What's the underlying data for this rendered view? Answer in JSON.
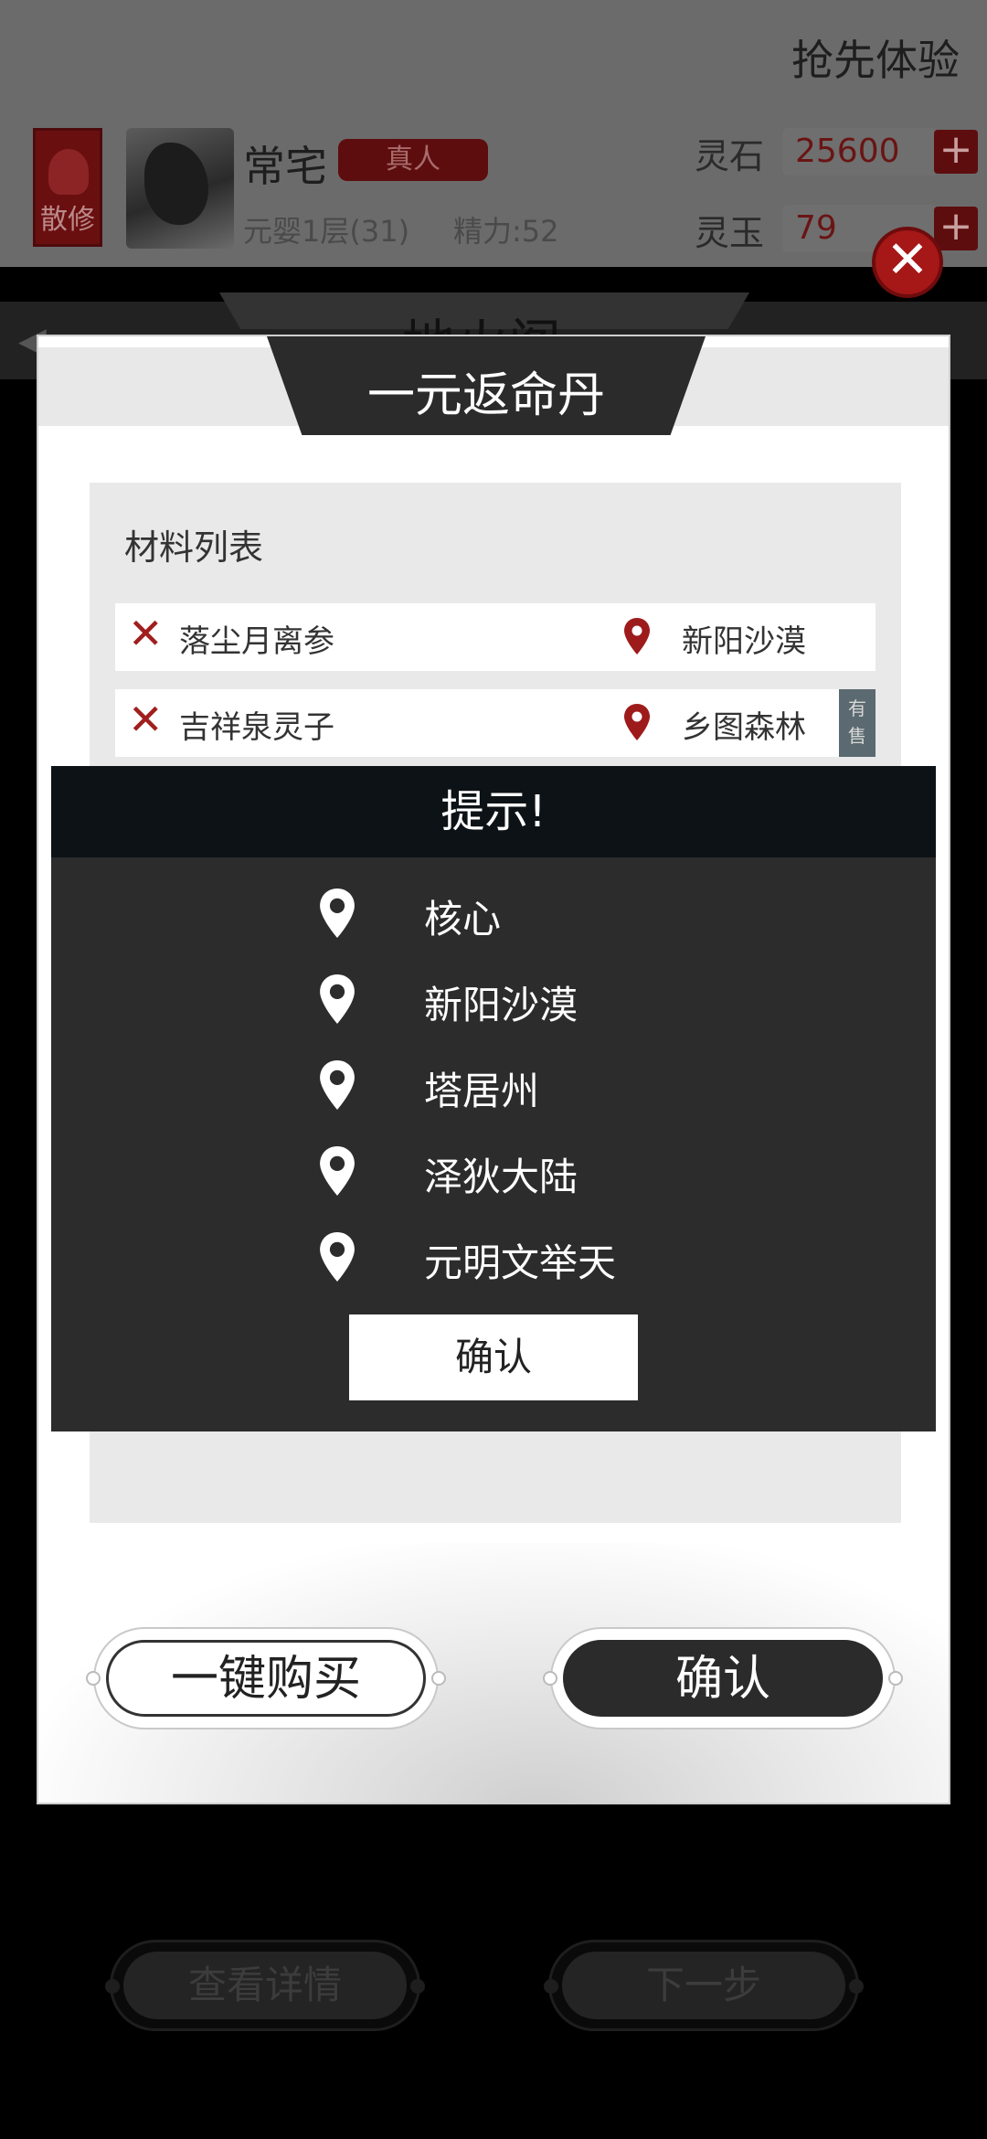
{
  "header": {
    "early_experience": "抢先体验",
    "badge_label": "散修",
    "player_name": "常宅",
    "real_tag": "真人",
    "realm": "元婴1层(31)",
    "energy": "精力:52",
    "resources": [
      {
        "label": "灵石",
        "value": "25600",
        "plus": "+"
      },
      {
        "label": "灵玉",
        "value": "79",
        "plus": "+"
      }
    ]
  },
  "background_page": {
    "title": "地火阁",
    "back_label": "◀",
    "bottom_buttons": [
      "查看详情",
      "下一步"
    ]
  },
  "close_symbol": "✕",
  "recipe": {
    "title": "一元返命丹",
    "materials_title": "材料列表",
    "materials": [
      {
        "status_icon": "✕",
        "name": "落尘月离参",
        "location": "新阳沙漠",
        "sale": ""
      },
      {
        "status_icon": "✕",
        "name": "吉祥泉灵子",
        "location": "乡图森林",
        "sale": "有售"
      }
    ],
    "buy_all_label": "一键购买",
    "confirm_label": "确认"
  },
  "hint": {
    "title": "提示!",
    "locations": [
      "核心",
      "新阳沙漠",
      "塔居州",
      "泽狄大陆",
      "元明文举天"
    ],
    "confirm_label": "确认"
  },
  "colors": {
    "accent_red": "#a11e1e",
    "dark_panel": "#2c2c2c",
    "hint_header": "#0c1215"
  }
}
